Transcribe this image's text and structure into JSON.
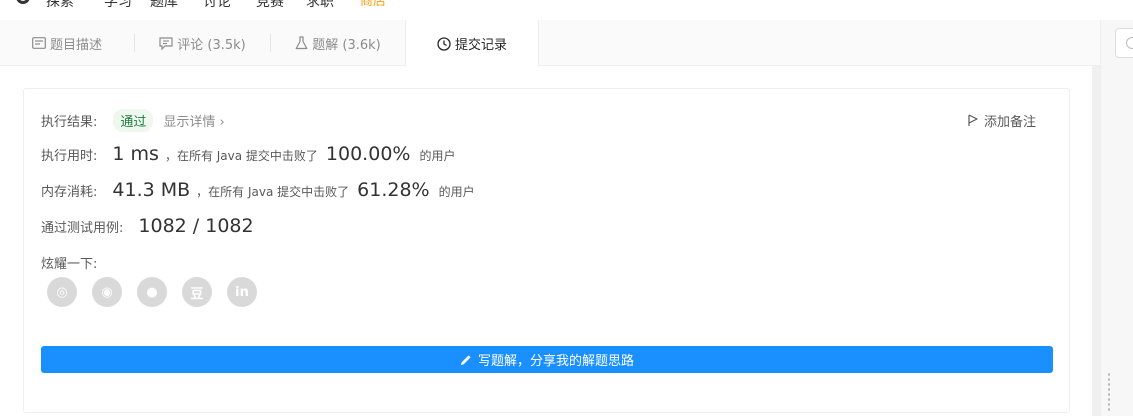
{
  "topnav": {
    "items": [
      {
        "name": "nav-item-explore",
        "label": "探索"
      },
      {
        "name": "nav-item-study",
        "label": "学习"
      },
      {
        "name": "nav-item-problems",
        "label": "题库"
      },
      {
        "name": "nav-item-discuss",
        "label": "讨论"
      },
      {
        "name": "nav-item-contest",
        "label": "竞赛"
      },
      {
        "name": "nav-item-jobs",
        "label": "求职"
      }
    ],
    "accent_label": "商店"
  },
  "tabs": [
    {
      "label": "题目描述",
      "icon": "description-icon"
    },
    {
      "label": "评论 (3.5k)",
      "icon": "comment-icon"
    },
    {
      "label": "题解 (3.6k)",
      "icon": "flask-icon"
    },
    {
      "label": "提交记录",
      "icon": "clock-icon",
      "active": true
    }
  ],
  "result": {
    "label": "执行结果:",
    "status": "通过",
    "details_link": "显示详情 ›",
    "add_note": "添加备注"
  },
  "runtime": {
    "label": "执行用时:",
    "value": "1 ms",
    "mid": "，在所有 Java 提交中击败了",
    "percent": "100.00%",
    "suffix": "的用户"
  },
  "memory": {
    "label": "内存消耗:",
    "value": "41.3 MB",
    "mid": "，在所有 Java 提交中击败了",
    "percent": "61.28%",
    "suffix": "的用户"
  },
  "tests": {
    "label": "通过测试用例:",
    "value": "1082 / 1082"
  },
  "share": {
    "label": "炫耀一下:",
    "icons": [
      {
        "name": "wechat-icon",
        "glyph": "◎"
      },
      {
        "name": "weibo-icon",
        "glyph": "◉"
      },
      {
        "name": "qq-icon",
        "glyph": "●"
      },
      {
        "name": "douban-icon",
        "glyph": "豆"
      },
      {
        "name": "linkedin-icon",
        "glyph": "in"
      }
    ]
  },
  "write_button": "写题解，分享我的解题思路",
  "colors": {
    "primary": "#1a90ff",
    "accent": "#ffa116",
    "pass_bg": "#eef8ee"
  }
}
